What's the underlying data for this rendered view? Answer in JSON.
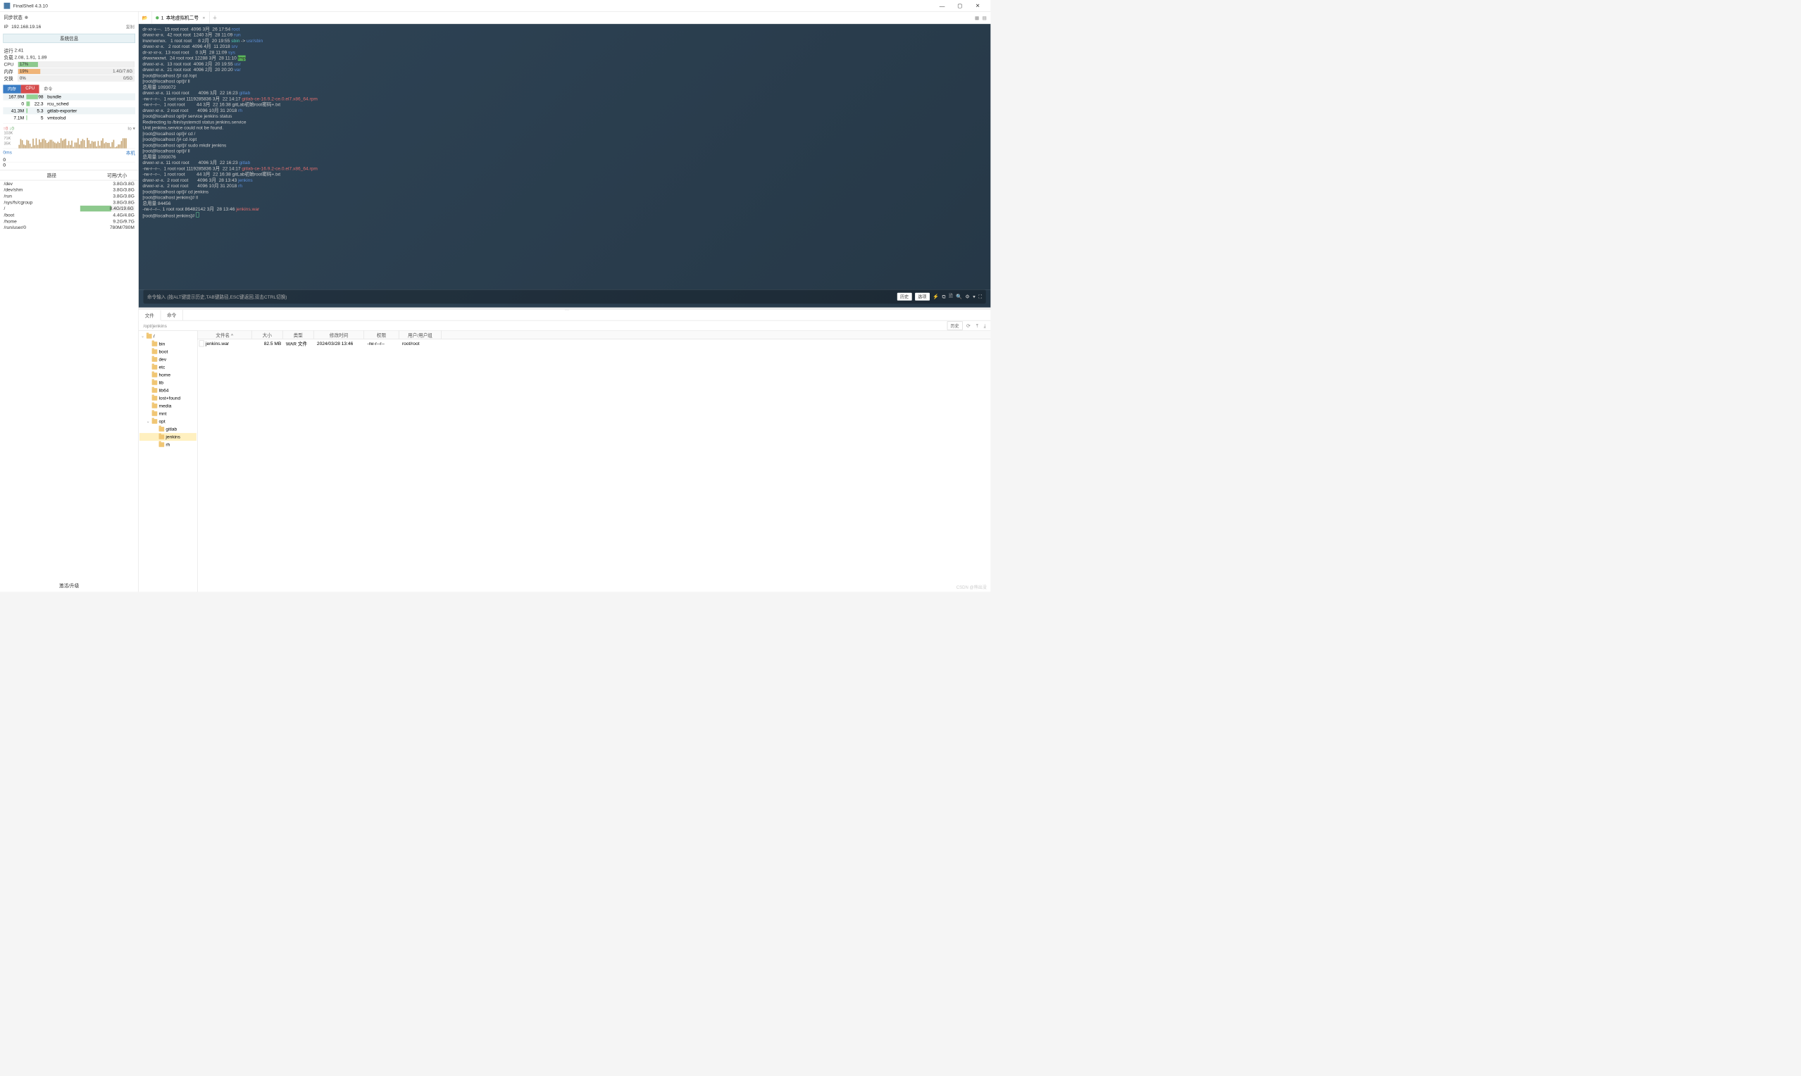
{
  "app": {
    "title": "FinalShell 4.3.10"
  },
  "window_controls": {
    "min": "—",
    "max": "▢",
    "close": "✕"
  },
  "sync": {
    "label": "同步状态"
  },
  "ip": {
    "label": "IP",
    "value": "192.168.19.16",
    "copy": "复制"
  },
  "sysinfo_btn": "系统信息",
  "runtime": {
    "label": "运行",
    "value": "2:41"
  },
  "load": {
    "label": "负载",
    "value": "2.08, 1.91, 1.89"
  },
  "cpu": {
    "label": "CPU",
    "pct": "17%",
    "width": 17
  },
  "mem": {
    "label": "内存",
    "pct": "19%",
    "width": 19,
    "detail": "1.4G/7.6G"
  },
  "swap": {
    "label": "交换",
    "pct": "0%",
    "width": 0,
    "detail": "0/5G"
  },
  "mini_tabs": {
    "mem": "内存",
    "cpu": "CPU",
    "cmd": "命令"
  },
  "procs": [
    {
      "mem": "167.9M",
      "cpu": "98",
      "pb": 60,
      "name": "bundle"
    },
    {
      "mem": "0",
      "cpu": "22.3",
      "pb": 18,
      "name": "rcu_sched"
    },
    {
      "mem": "41.3M",
      "cpu": "5.3",
      "pb": 5,
      "name": "gitlab-exporter"
    },
    {
      "mem": "7.1M",
      "cpu": "5",
      "pb": 4,
      "name": "vmtoolsd"
    }
  ],
  "net": {
    "up": "↑0",
    "dn": "↓0",
    "io_label": "Io  ▾",
    "axis": [
      "103K",
      "71K",
      "35K"
    ],
    "ms": "0ms",
    "host": "本机",
    "z1": "0",
    "z2": "0"
  },
  "disk_header": {
    "path": "路径",
    "size": "可用/大小"
  },
  "disks": [
    {
      "path": "/dev",
      "size": "3.8G/3.8G",
      "bar": 0
    },
    {
      "path": "/dev/shm",
      "size": "3.8G/3.8G",
      "bar": 0
    },
    {
      "path": "/run",
      "size": "3.8G/3.8G",
      "bar": 0
    },
    {
      "path": "/sys/fs/cgroup",
      "size": "3.8G/3.8G",
      "bar": 0
    },
    {
      "path": "/",
      "size": "8.4G/19.6G",
      "bar": 57
    },
    {
      "path": "/boot",
      "size": "4.4G/4.8G",
      "bar": 0
    },
    {
      "path": "/home",
      "size": "9.2G/9.7G",
      "bar": 0
    },
    {
      "path": "/run/user/0",
      "size": "780M/780M",
      "bar": 0
    }
  ],
  "activate": "激活/升级",
  "session_tab": {
    "num": "1",
    "name": "本地虚拟机二号"
  },
  "terminal_lines": [
    [
      {
        "t": "dr-xr-x---.  15 root root  4096 3月  26 17:54 "
      },
      {
        "t": "root",
        "c": "blue"
      }
    ],
    [
      {
        "t": "drwxr-xr-x.  42 root root  1240 3月  28 11:09 "
      },
      {
        "t": "run",
        "c": "blue"
      }
    ],
    [
      {
        "t": "lrwxrwxrwx.   1 root root     8 2月  20 19:55 "
      },
      {
        "t": "sbin",
        "c": "cyan"
      },
      {
        "t": " -> "
      },
      {
        "t": "usr/sbin",
        "c": "blue"
      }
    ],
    [
      {
        "t": "drwxr-xr-x.   2 root root  4096 4月  11 2018 "
      },
      {
        "t": "srv",
        "c": "blue"
      }
    ],
    [
      {
        "t": "dr-xr-xr-x.  13 root root     0 3月  28 11:09 "
      },
      {
        "t": "sys",
        "c": "blue"
      }
    ],
    [
      {
        "t": "drwxrwxrwt.  24 root root 12288 3月  28 11:10 "
      },
      {
        "t": "tmp",
        "c": "green-bg"
      }
    ],
    [
      {
        "t": "drwxr-xr-x.  13 root root  4096 2月  20 19:55 "
      },
      {
        "t": "usr",
        "c": "blue"
      }
    ],
    [
      {
        "t": "drwxr-xr-x.  21 root root  4096 2月  20 20:20 "
      },
      {
        "t": "var",
        "c": "blue"
      }
    ],
    [
      {
        "t": "[root@localhost /]# cd /opt"
      }
    ],
    [
      {
        "t": "[root@localhost opt]# ll"
      }
    ],
    [
      {
        "t": "总用量 1093072"
      }
    ],
    [
      {
        "t": "drwxr-xr-x. 11 root root       4096 3月  22 16:23 "
      },
      {
        "t": "gitlab",
        "c": "blue"
      }
    ],
    [
      {
        "t": "-rw-r--r--.  1 root root 1119285836 3月  22 14:17 "
      },
      {
        "t": "gitlab-ce-16.9.2-ce.0.el7.x86_64.rpm",
        "c": "red"
      }
    ],
    [
      {
        "t": "-rw-r--r--.  1 root root         44 3月  22 16:38 gitLab初始root密码+.txt"
      }
    ],
    [
      {
        "t": "drwxr-xr-x.  2 root root       4096 10月 31 2018 "
      },
      {
        "t": "rh",
        "c": "blue"
      }
    ],
    [
      {
        "t": "[root@localhost opt]# service jenkins status"
      }
    ],
    [
      {
        "t": "Redirecting to /bin/systemctl status jenkins.service"
      }
    ],
    [
      {
        "t": "Unit jenkins.service could not be found."
      }
    ],
    [
      {
        "t": "[root@localhost opt]# cd /"
      }
    ],
    [
      {
        "t": "[root@localhost /]# cd /opt"
      }
    ],
    [
      {
        "t": "[root@localhost opt]# sudo mkdir jenkins"
      }
    ],
    [
      {
        "t": "[root@localhost opt]# ll"
      }
    ],
    [
      {
        "t": "总用量 1093076"
      }
    ],
    [
      {
        "t": "drwxr-xr-x. 11 root root       4096 3月  22 16:23 "
      },
      {
        "t": "gitlab",
        "c": "blue"
      }
    ],
    [
      {
        "t": "-rw-r--r--.  1 root root 1119285836 3月  22 14:17 "
      },
      {
        "t": "gitlab-ce-16.9.2-ce.0.el7.x86_64.rpm",
        "c": "red"
      }
    ],
    [
      {
        "t": "-rw-r--r--.  1 root root         44 3月  22 16:38 gitLab初始root密码+.txt"
      }
    ],
    [
      {
        "t": "drwxr-xr-x.  2 root root       4096 3月  28 13:43 "
      },
      {
        "t": "jenkins",
        "c": "blue"
      }
    ],
    [
      {
        "t": "drwxr-xr-x.  2 root root       4096 10月 31 2018 "
      },
      {
        "t": "rh",
        "c": "blue"
      }
    ],
    [
      {
        "t": "[root@localhost opt]# cd jenkins"
      }
    ],
    [
      {
        "t": "[root@localhost jenkins]# ll"
      }
    ],
    [
      {
        "t": "总用量 84456"
      }
    ],
    [
      {
        "t": "-rw-r--r--. 1 root root 86482142 3月  28 13:46 "
      },
      {
        "t": "jenkins.war",
        "c": "red"
      }
    ],
    [
      {
        "t": "[root@localhost jenkins]# "
      },
      {
        "t": "",
        "c": "cursor"
      }
    ]
  ],
  "cmd_input": {
    "placeholder": "命令输入 (按ALT键提示历史,TAB键路径,ESC键返回,双击CTRL切换)",
    "history": "历史",
    "options": "选项"
  },
  "file_tabs": {
    "files": "文件",
    "cmds": "命令"
  },
  "path_bar": {
    "path": "/opt/jenkins",
    "history": "历史"
  },
  "tree": [
    {
      "name": "/",
      "depth": 0,
      "exp": true
    },
    {
      "name": "bin",
      "depth": 1
    },
    {
      "name": "boot",
      "depth": 1
    },
    {
      "name": "dev",
      "depth": 1
    },
    {
      "name": "etc",
      "depth": 1
    },
    {
      "name": "home",
      "depth": 1
    },
    {
      "name": "lib",
      "depth": 1
    },
    {
      "name": "lib64",
      "depth": 1
    },
    {
      "name": "lost+found",
      "depth": 1
    },
    {
      "name": "media",
      "depth": 1
    },
    {
      "name": "mnt",
      "depth": 1
    },
    {
      "name": "opt",
      "depth": 1,
      "exp": true
    },
    {
      "name": "gitlab",
      "depth": 2
    },
    {
      "name": "jenkins",
      "depth": 2,
      "sel": true
    },
    {
      "name": "rh",
      "depth": 2
    }
  ],
  "fl_header": {
    "name": "文件名 ^",
    "size": "大小",
    "type": "类型",
    "date": "修改时间",
    "perm": "权限",
    "own": "用户/用户组"
  },
  "files": [
    {
      "name": "jenkins.war",
      "size": "82.5 MB",
      "type": "WAR 文件",
      "date": "2024/03/28 13:46",
      "perm": "-rw-r--r--",
      "own": "root/root"
    }
  ],
  "watermark": "CSDN @熊出没"
}
